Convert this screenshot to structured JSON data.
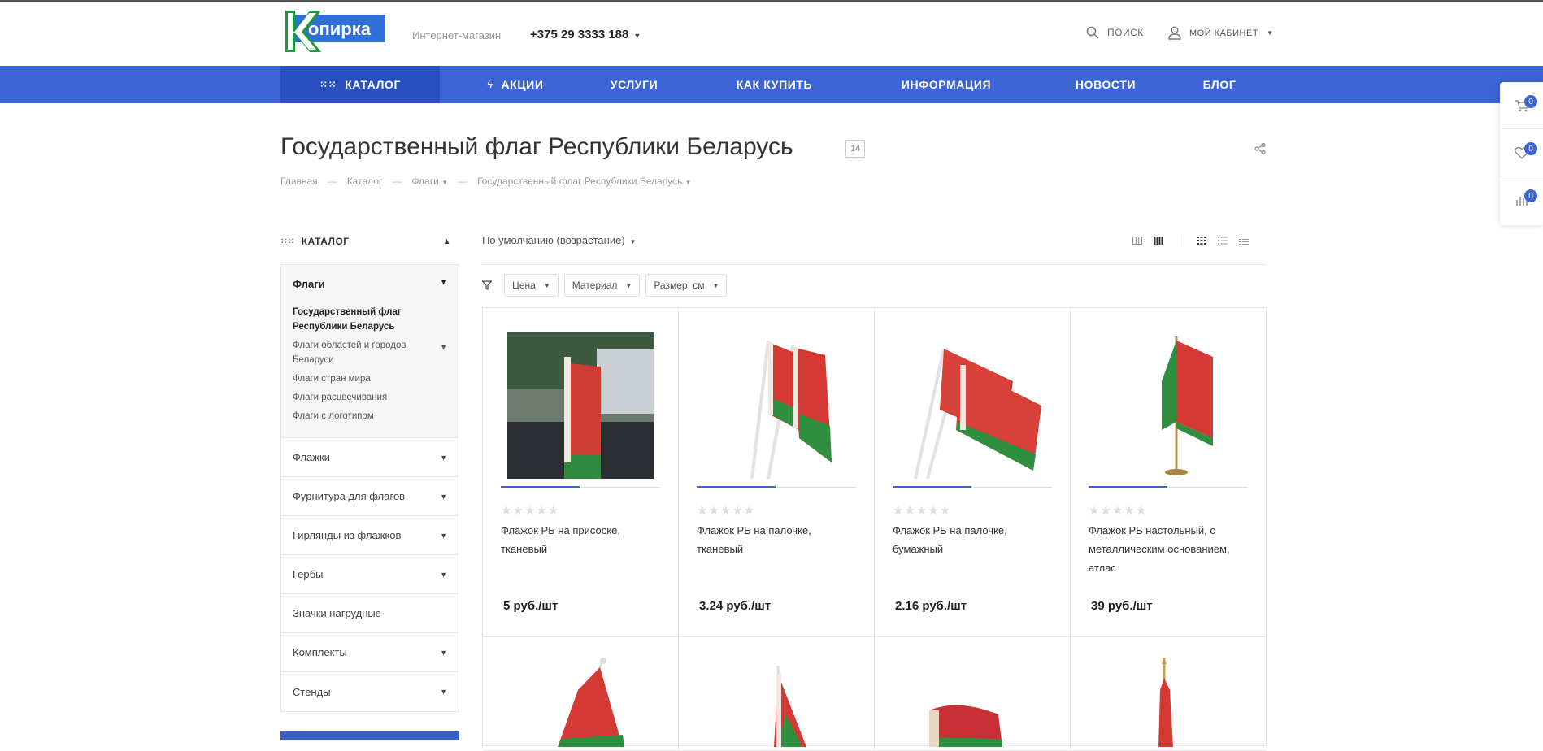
{
  "header": {
    "logo_text": "Копирка",
    "shop_label": "Интернет-магазин",
    "phone": "+375 29 3333 188",
    "search_label": "ПОИСК",
    "cabinet_label": "МОЙ КАБИНЕТ"
  },
  "nav": {
    "items": [
      {
        "label": "КАТАЛОГ",
        "icon": "grid-icon"
      },
      {
        "label": "АКЦИИ",
        "icon": "lightning-icon"
      },
      {
        "label": "УСЛУГИ"
      },
      {
        "label": "КАК КУПИТЬ"
      },
      {
        "label": "ИНФОРМАЦИЯ"
      },
      {
        "label": "НОВОСТИ"
      },
      {
        "label": "БЛОГ"
      }
    ],
    "accent": "#3c64d4"
  },
  "right_panel": {
    "cart_count": "0",
    "wishlist_count": "0",
    "compare_count": "0"
  },
  "page": {
    "title": "Государственный флаг Республики Беларусь",
    "count": "14"
  },
  "breadcrumb": [
    "Главная",
    "Каталог",
    "Флаги",
    "Государственный флаг Республики Беларусь"
  ],
  "sidebar": {
    "heading": "КАТАЛОГ",
    "main": "Флаги",
    "sub": [
      {
        "label": "Государственный флаг Республики Беларусь",
        "active": true
      },
      {
        "label": "Флаги областей и городов Беларуси",
        "has_children": true
      },
      {
        "label": "Флаги стран мира"
      },
      {
        "label": "Флаги расцвечивания"
      },
      {
        "label": "Флаги с логотипом"
      }
    ],
    "items": [
      {
        "label": "Флажки",
        "has_children": true
      },
      {
        "label": "Фурнитура для флагов",
        "has_children": true
      },
      {
        "label": "Гирлянды из флажков",
        "has_children": true
      },
      {
        "label": "Гербы",
        "has_children": true
      },
      {
        "label": "Значки нагрудные",
        "has_children": false
      },
      {
        "label": "Комплекты",
        "has_children": true
      },
      {
        "label": "Стенды",
        "has_children": true
      }
    ]
  },
  "toolbar": {
    "sort_label": "По умолчанию (возрастание)",
    "filters": [
      "Цена",
      "Материал",
      "Размер, см"
    ]
  },
  "products": [
    {
      "name": "Флажок РБ на присоске, тканевый",
      "price": "5 руб./шт"
    },
    {
      "name": "Флажок РБ на палочке, тканевый",
      "price": "3.24 руб./шт"
    },
    {
      "name": "Флажок РБ на палочке, бумажный",
      "price": "2.16 руб./шт"
    },
    {
      "name": "Флажок РБ настольный, с металлическим основанием, атлас",
      "price": "39 руб./шт"
    }
  ]
}
